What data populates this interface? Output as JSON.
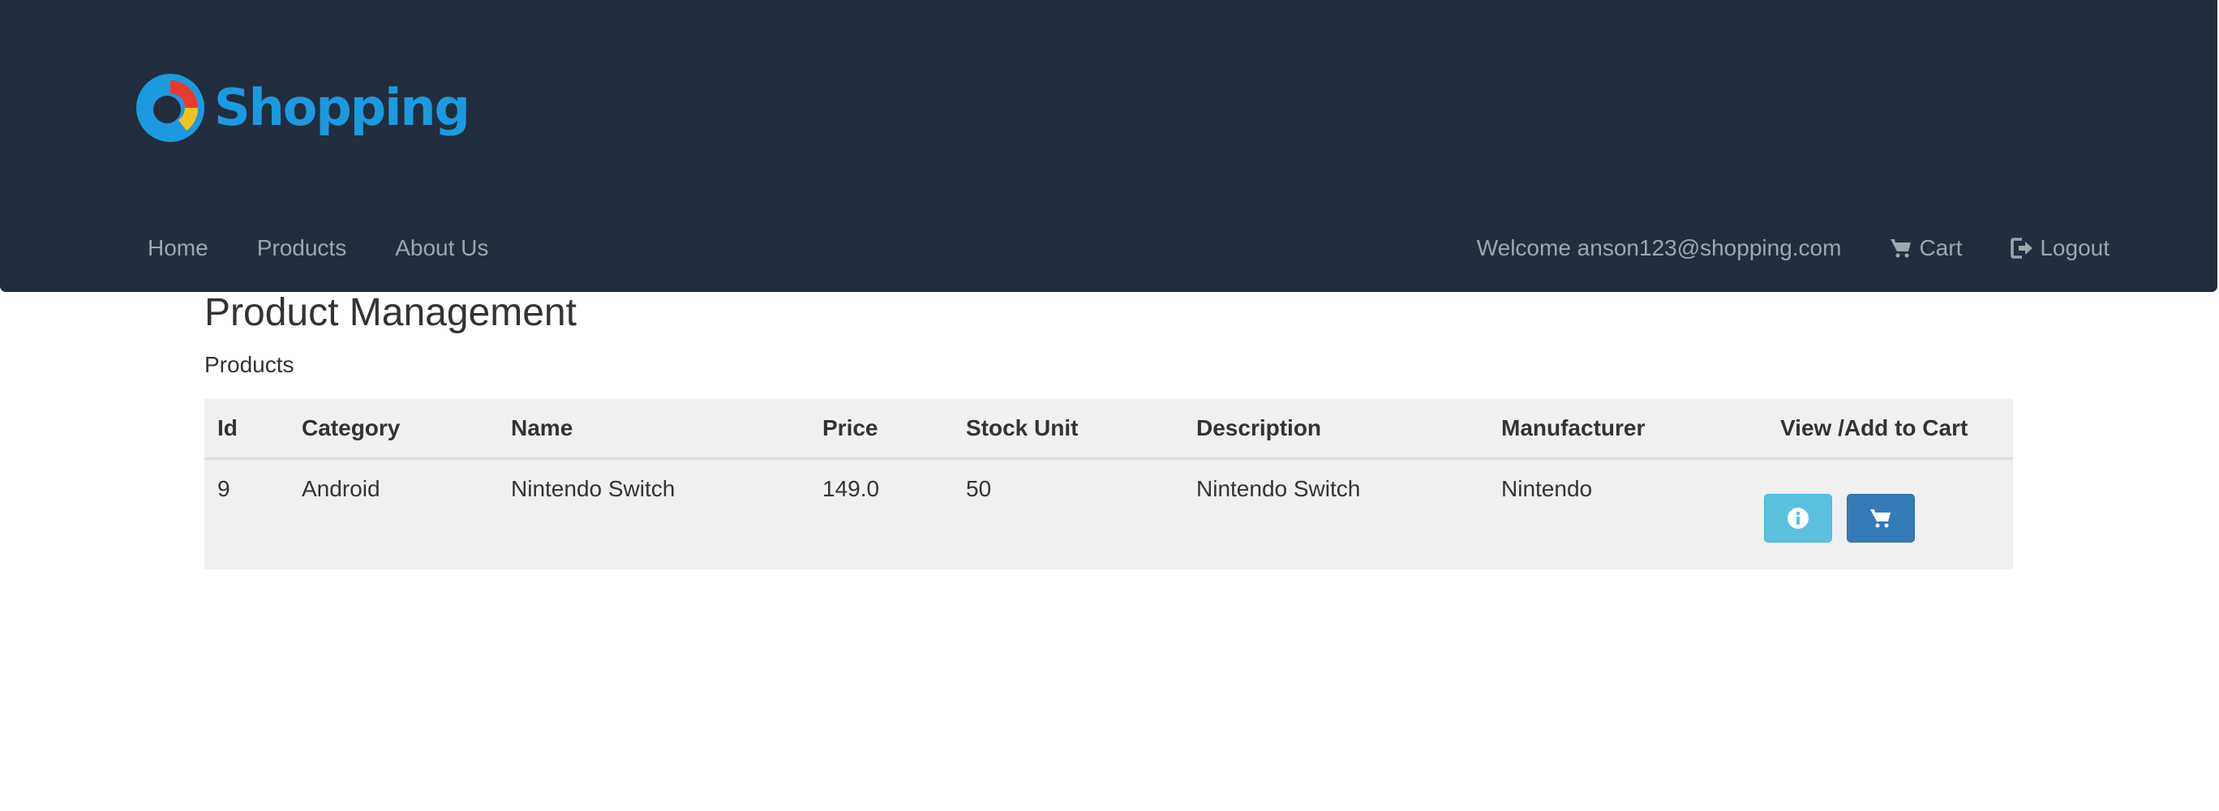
{
  "brand": {
    "name": "Shopping",
    "logo_icon": "shopping-logo-icon",
    "color": "#1b9ae0"
  },
  "nav": {
    "left": [
      {
        "label": "Home"
      },
      {
        "label": "Products"
      },
      {
        "label": "About Us"
      }
    ],
    "welcome": "Welcome anson123@shopping.com",
    "cart": {
      "label": "Cart",
      "icon": "cart-icon"
    },
    "logout": {
      "label": "Logout",
      "icon": "logout-icon"
    }
  },
  "page": {
    "title": "Product Management",
    "section": "Products"
  },
  "table": {
    "headers": [
      "Id",
      "Category",
      "Name",
      "Price",
      "Stock Unit",
      "Description",
      "Manufacturer",
      "View /Add to Cart"
    ],
    "rows": [
      {
        "id": "9",
        "category": "Android",
        "name": "Nintendo Switch",
        "price": "149.0",
        "stock": "50",
        "description": "Nintendo Switch",
        "manufacturer": "Nintendo",
        "view_icon": "info-icon",
        "add_icon": "cart-icon"
      }
    ]
  },
  "colors": {
    "navbar_bg": "#222d3e",
    "nav_text": "#a1a6ad",
    "table_bg": "#f0f0f0",
    "info_button": "#5bc0de",
    "primary_button": "#337ab7"
  }
}
